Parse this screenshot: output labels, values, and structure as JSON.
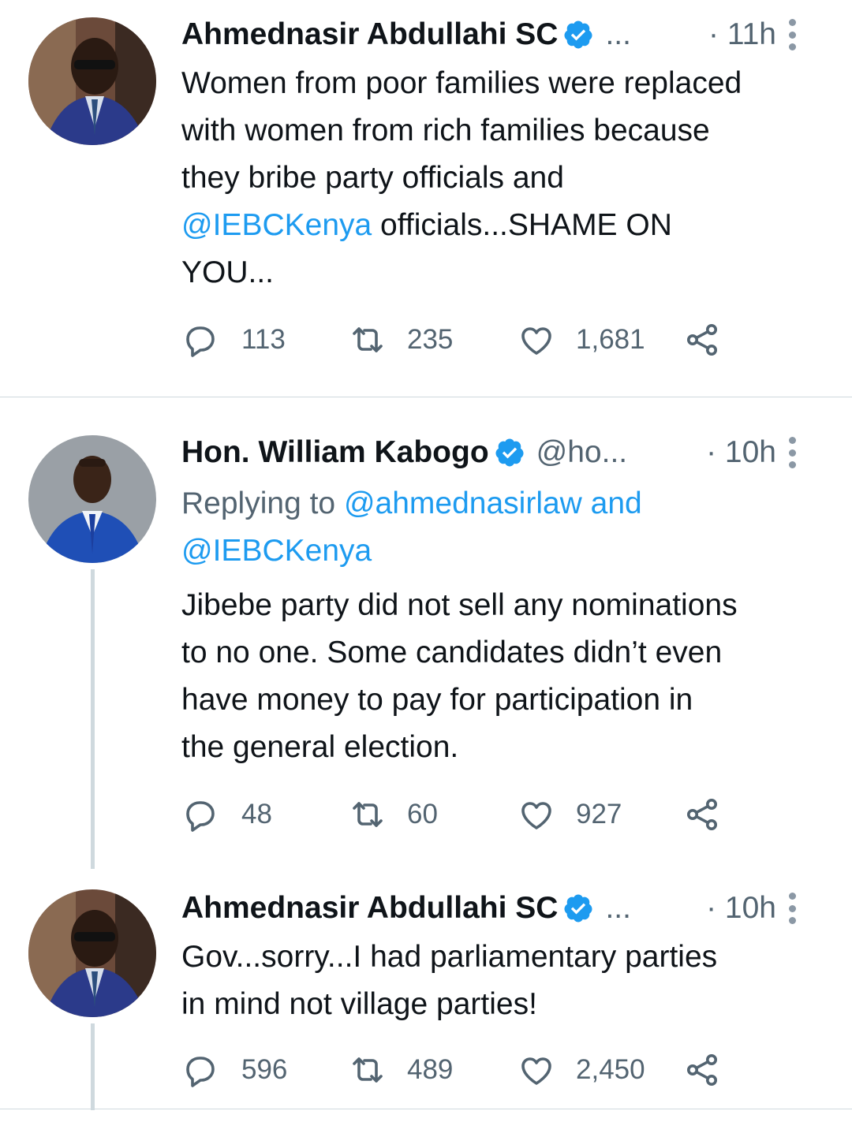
{
  "tweets": [
    {
      "name": "Ahmednasir Abdullahi SC",
      "handle": "...",
      "time": "· 11h",
      "text_lines": [
        "Women from poor families were replaced",
        "with women from rich families because",
        "they bribe party officials and"
      ],
      "mention": "@IEBCKenya",
      "text_after_mention": " officials...SHAME ON",
      "text_last_line": "YOU...",
      "replies": "113",
      "retweets": "235",
      "likes": "1,681"
    },
    {
      "name": "Hon. William Kabogo",
      "handle": "@ho...",
      "time": "· 10h",
      "replying_prefix": "Replying to ",
      "replying_user": "@ahmednasirlaw",
      "replying_and": " and",
      "replying_user2": "@IEBCKenya",
      "text_lines": [
        "Jibebe party did not sell any nominations",
        "to no one. Some candidates didn’t even",
        "have money to pay for participation in",
        "the general election."
      ],
      "replies": "48",
      "retweets": "60",
      "likes": "927"
    },
    {
      "name": "Ahmednasir Abdullahi SC",
      "handle": "...",
      "time": "· 10h",
      "text_lines": [
        "Gov...sorry...I had parliamentary parties",
        "in mind not village parties!"
      ],
      "replies": "596",
      "retweets": "489",
      "likes": "2,450"
    }
  ],
  "colors": {
    "link": "#1d9bf0",
    "secondary": "#536471",
    "verified": "#1d9bf0",
    "divider": "#cfd9de"
  },
  "icons": [
    "reply-icon",
    "retweet-icon",
    "like-icon",
    "share-icon",
    "verified-badge-icon",
    "more-icon"
  ]
}
